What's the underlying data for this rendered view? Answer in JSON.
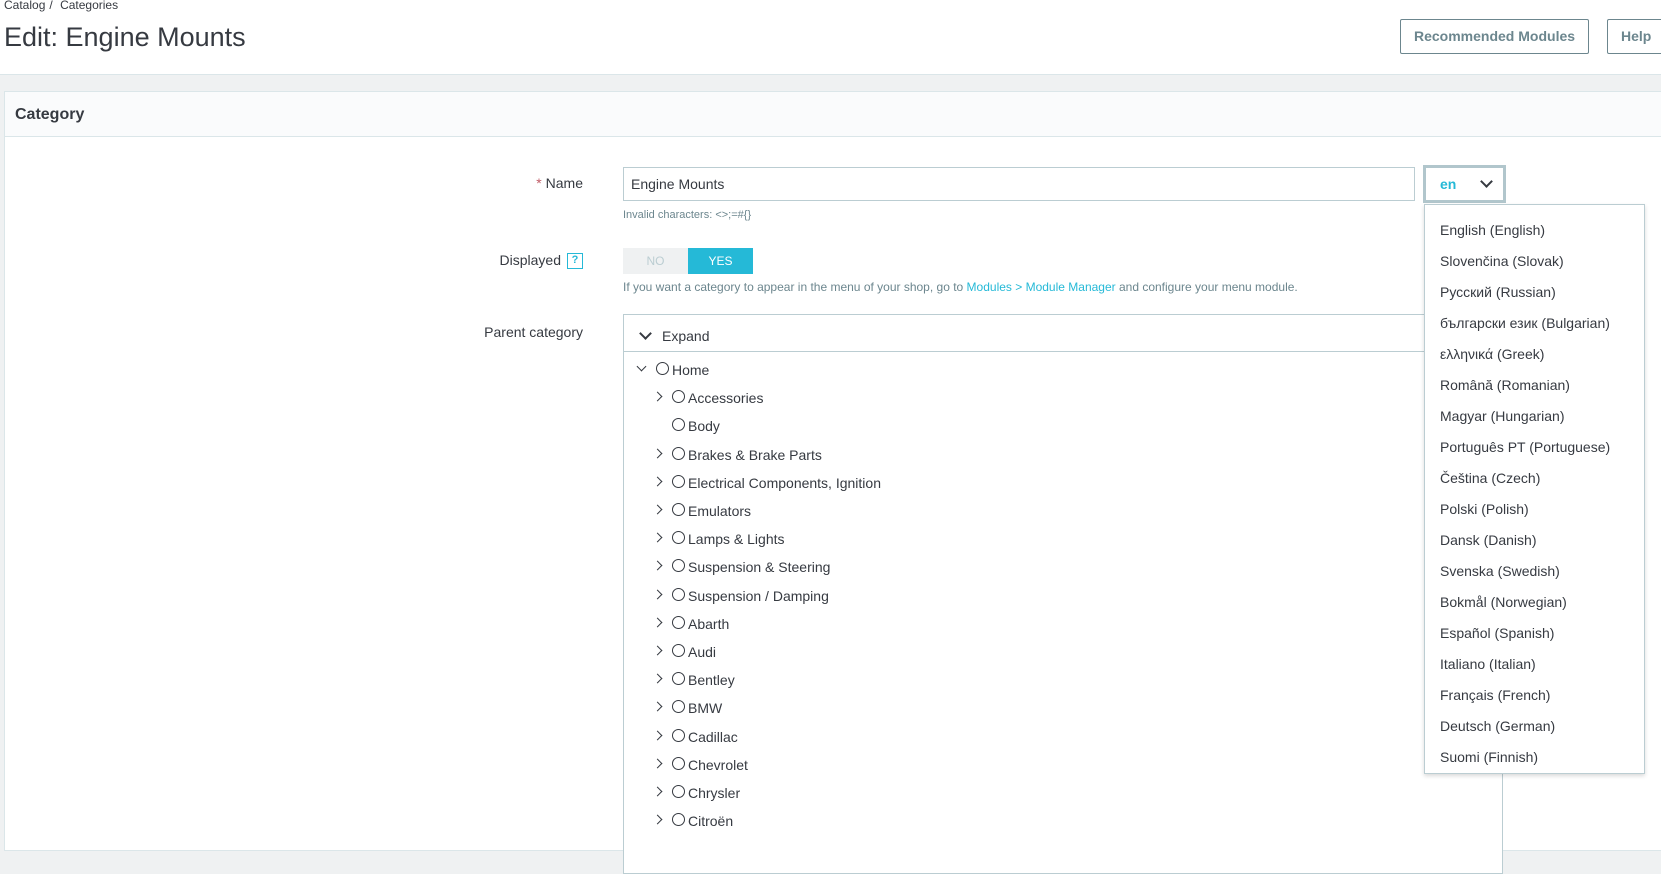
{
  "breadcrumb": {
    "item1": "Catalog",
    "sep": "/",
    "item2": "Categories"
  },
  "page_title": "Edit: Engine Mounts",
  "toolbar": {
    "recommended_label": "Recommended Modules",
    "help_label": "Help"
  },
  "card": {
    "title": "Category"
  },
  "name_field": {
    "required_mark": "*",
    "label": "Name",
    "value": "Engine Mounts",
    "help": "Invalid characters: <>;=#{}"
  },
  "lang_select": {
    "value": "en"
  },
  "displayed": {
    "label": "Displayed",
    "help_icon": "?",
    "no_label": "NO",
    "yes_label": "YES",
    "selected": "YES",
    "help_prefix": "If you want a category to appear in the menu of your shop, go to ",
    "help_link": "Modules > Module Manager",
    "help_suffix": " and configure your menu module."
  },
  "parent_category": {
    "label": "Parent category",
    "expand_label": "Expand",
    "root": "Home",
    "children": [
      "Accessories",
      "Body",
      "Brakes & Brake Parts",
      "Electrical Components, Ignition",
      "Emulators",
      "Lamps & Lights",
      "Suspension & Steering",
      "Suspension / Damping",
      "Abarth",
      "Audi",
      "Bentley",
      "BMW",
      "Cadillac",
      "Chevrolet",
      "Chrysler",
      "Citroën"
    ],
    "no_arrow": [
      "Body"
    ]
  },
  "languages": [
    "English (English)",
    "Slovenčina (Slovak)",
    "Русский (Russian)",
    "български език (Bulgarian)",
    "ελληνικά (Greek)",
    "Română (Romanian)",
    "Magyar (Hungarian)",
    "Português PT (Portuguese)",
    "Čeština (Czech)",
    "Polski (Polish)",
    "Dansk (Danish)",
    "Svenska (Swedish)",
    "Bokmål (Norwegian)",
    "Español (Spanish)",
    "Italiano (Italian)",
    "Français (French)",
    "Deutsch (German)",
    "Suomi (Finnish)"
  ],
  "colors": {
    "accent": "#25b9d7",
    "text": "#363a41",
    "muted": "#6c868e",
    "border": "#bbcdd2",
    "required": "#c05c67"
  }
}
